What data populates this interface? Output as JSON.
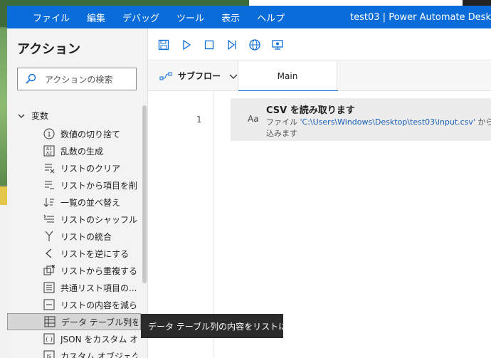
{
  "menu": [
    "ファイル",
    "編集",
    "デバッグ",
    "ツール",
    "表示",
    "ヘルプ"
  ],
  "window_title": "test03 | Power Automate Desk",
  "actions_panel": {
    "title": "アクション",
    "search_placeholder": "アクションの検索",
    "group": "変数",
    "items": [
      "数値の切り捨て",
      "乱数の生成",
      "リストのクリア",
      "リストから項目を削除",
      "一覧の並べ替え",
      "リストのシャッフル",
      "リストの統合",
      "リストを逆にする",
      "リストから重複する...",
      "共通リスト項目の...",
      "リストの内容を減らす",
      "データ テーブル列をリ...",
      "JSON をカスタム オ...",
      "カスタム オブジェクト..."
    ]
  },
  "tabs": {
    "subflow": "サブフロー",
    "main": "Main"
  },
  "flow": {
    "line": "1",
    "action_icon": "Aa",
    "action_title": "CSV を読み取ります",
    "desc_prefix": "ファイル ",
    "desc_path": "'C:\\Users\\Windows\\Desktop\\test03\\input.csv'",
    "desc_suffix": " から CSV",
    "desc_line2": "込みます"
  },
  "tooltip": "データ テーブル列の内容をリストに変換",
  "colors": {
    "accent": "#0a6cd8"
  }
}
